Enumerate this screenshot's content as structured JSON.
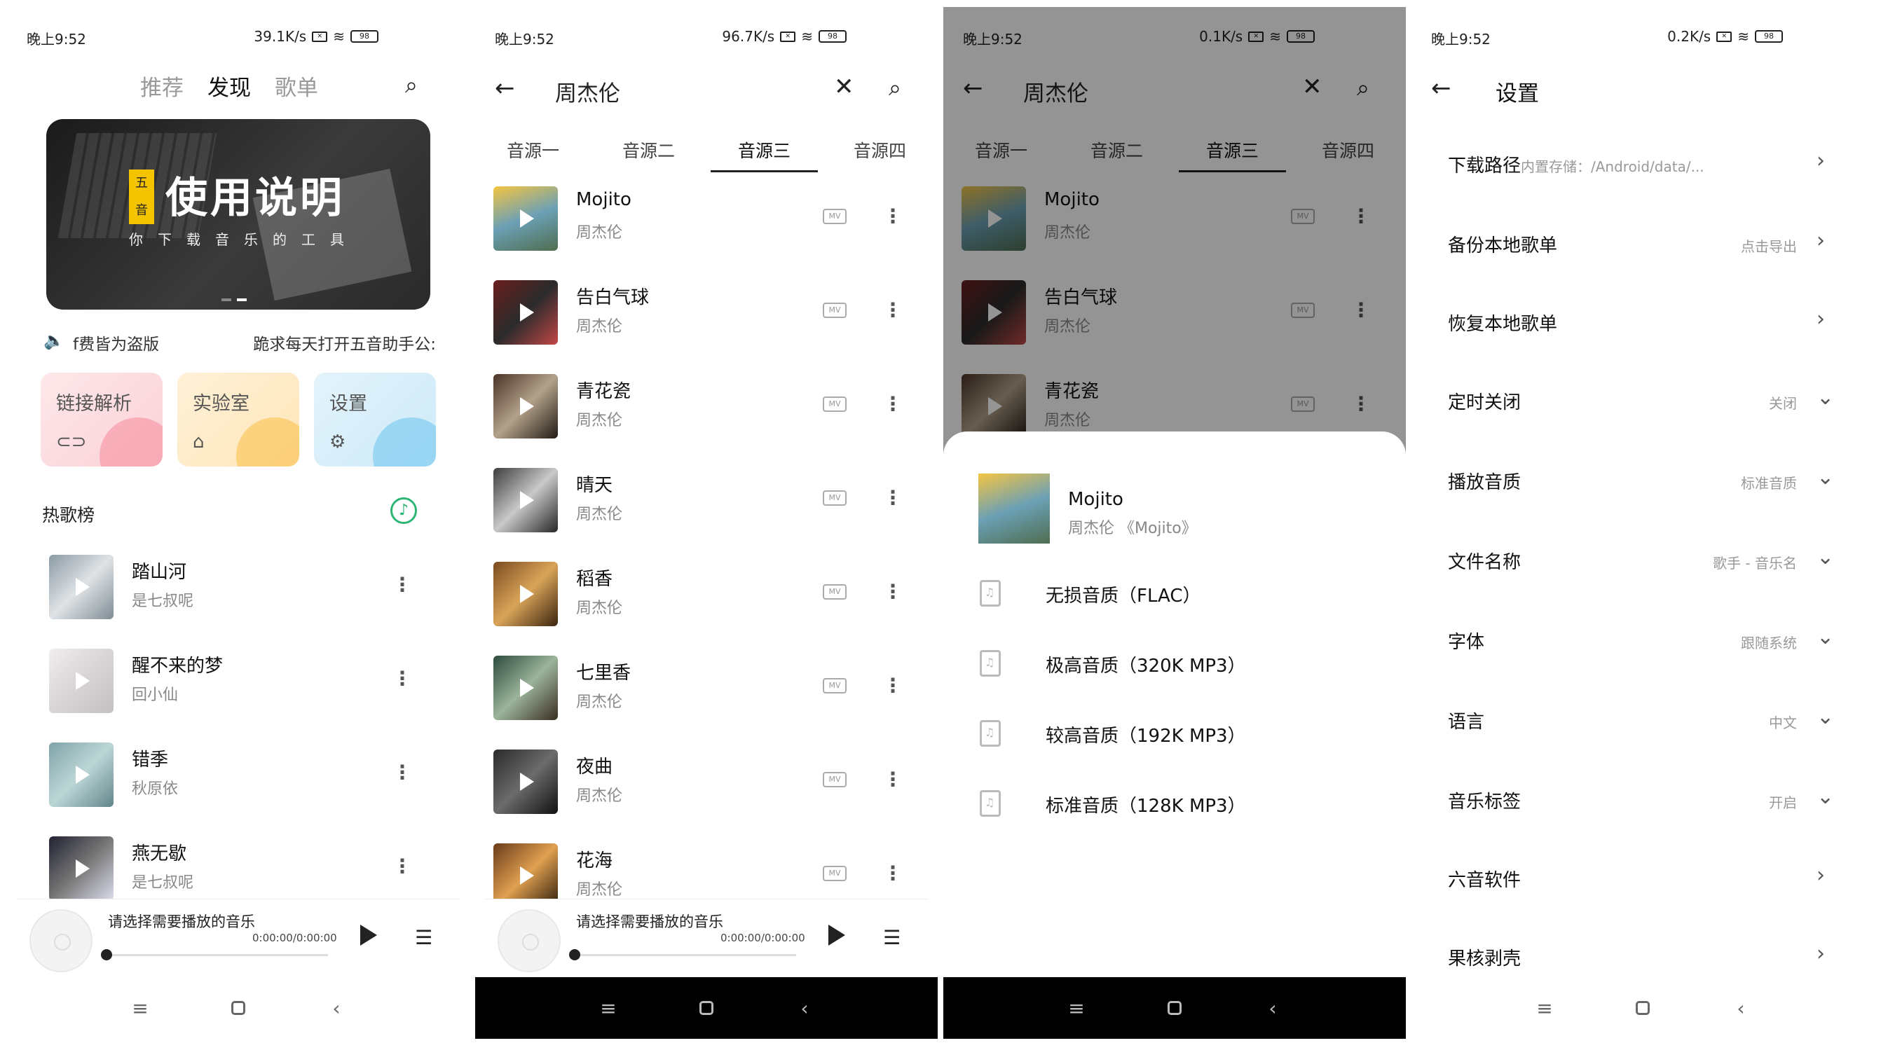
{
  "status_bars": [
    {
      "time": "晚上9:52",
      "speed": "39.1K/s",
      "battery": "98"
    },
    {
      "time": "晚上9:52",
      "speed": "96.7K/s",
      "battery": "98"
    },
    {
      "time": "晚上9:52",
      "speed": "0.1K/s",
      "battery": "98"
    },
    {
      "time": "晚上9:52",
      "speed": "0.2K/s",
      "battery": "98"
    }
  ],
  "home": {
    "tabs": [
      "推荐",
      "发现",
      "歌单"
    ],
    "active_tab": "发现",
    "banner": {
      "badge_top": "五",
      "badge_bottom": "音",
      "title": "使用说明",
      "subtitle": "你下载音乐的工具"
    },
    "notice_left": "f费皆为盗版",
    "notice_right": "跪求每天打开五音助手公:",
    "cards": [
      {
        "label": "链接解析",
        "icon": "link-icon"
      },
      {
        "label": "实验室",
        "icon": "bank-icon"
      },
      {
        "label": "设置",
        "icon": "gear-icon"
      }
    ],
    "hot_title": "热歌榜",
    "hot_songs": [
      {
        "name": "踏山河",
        "artist": "是七叔呢"
      },
      {
        "name": "醒不来的梦",
        "artist": "回小仙"
      },
      {
        "name": "错季",
        "artist": "秋原依"
      },
      {
        "name": "燕无歇",
        "artist": "是七叔呢"
      }
    ]
  },
  "player": {
    "title": "请选择需要播放的音乐",
    "time": "0:00:00/0:00:00"
  },
  "search": {
    "query": "周杰伦",
    "source_tabs": [
      "音源一",
      "音源二",
      "音源三",
      "音源四"
    ],
    "active_source": 2,
    "results": [
      {
        "name": "Mojito",
        "artist": "周杰伦"
      },
      {
        "name": "告白气球",
        "artist": "周杰伦"
      },
      {
        "name": "青花瓷",
        "artist": "周杰伦"
      },
      {
        "name": "晴天",
        "artist": "周杰伦"
      },
      {
        "name": "稻香",
        "artist": "周杰伦"
      },
      {
        "name": "七里香",
        "artist": "周杰伦"
      },
      {
        "name": "夜曲",
        "artist": "周杰伦"
      },
      {
        "name": "花海",
        "artist": "周杰伦"
      }
    ]
  },
  "quality_sheet": {
    "song_name": "Mojito",
    "song_sub": "周杰伦 《Mojito》",
    "options": [
      "无损音质（FLAC）",
      "极高音质（320K MP3）",
      "较高音质（192K MP3）",
      "标准音质（128K MP3）"
    ]
  },
  "settings": {
    "title": "设置",
    "rows": [
      {
        "label": "下载路径",
        "value": "内置存储：/Android/data/...",
        "control": "chevron-right",
        "inline": true
      },
      {
        "label": "备份本地歌单",
        "value": "点击导出",
        "control": "chevron-right"
      },
      {
        "label": "恢复本地歌单",
        "value": "",
        "control": "chevron-right"
      },
      {
        "label": "定时关闭",
        "value": "关闭",
        "control": "chevron-down"
      },
      {
        "label": "播放音质",
        "value": "标准音质",
        "control": "chevron-down"
      },
      {
        "label": "文件名称",
        "value": "歌手 - 音乐名",
        "control": "chevron-down"
      },
      {
        "label": "字体",
        "value": "跟随系统",
        "control": "chevron-down"
      },
      {
        "label": "语言",
        "value": "中文",
        "control": "chevron-down"
      },
      {
        "label": "音乐标签",
        "value": "开启",
        "control": "chevron-down"
      },
      {
        "label": "六音软件",
        "value": "",
        "control": "chevron-right"
      },
      {
        "label": "果核剥壳",
        "value": "",
        "control": "chevron-right"
      }
    ]
  },
  "glyphs": {
    "back": "←",
    "search": "⌕",
    "close": "✕",
    "more": "⋮",
    "chev_right": "›",
    "chev_down": "⌄",
    "speaker": "🔈",
    "note": "♪",
    "link": "⊂⊃",
    "bank": "⌂",
    "gear": "⚙",
    "menu": "≡",
    "nav_back": "‹",
    "wifi": "≋",
    "queue": "☰",
    "mv": "MV"
  },
  "colors": {
    "accent_green": "#2bb673",
    "overlay": "rgba(0,0,0,0.42)"
  }
}
